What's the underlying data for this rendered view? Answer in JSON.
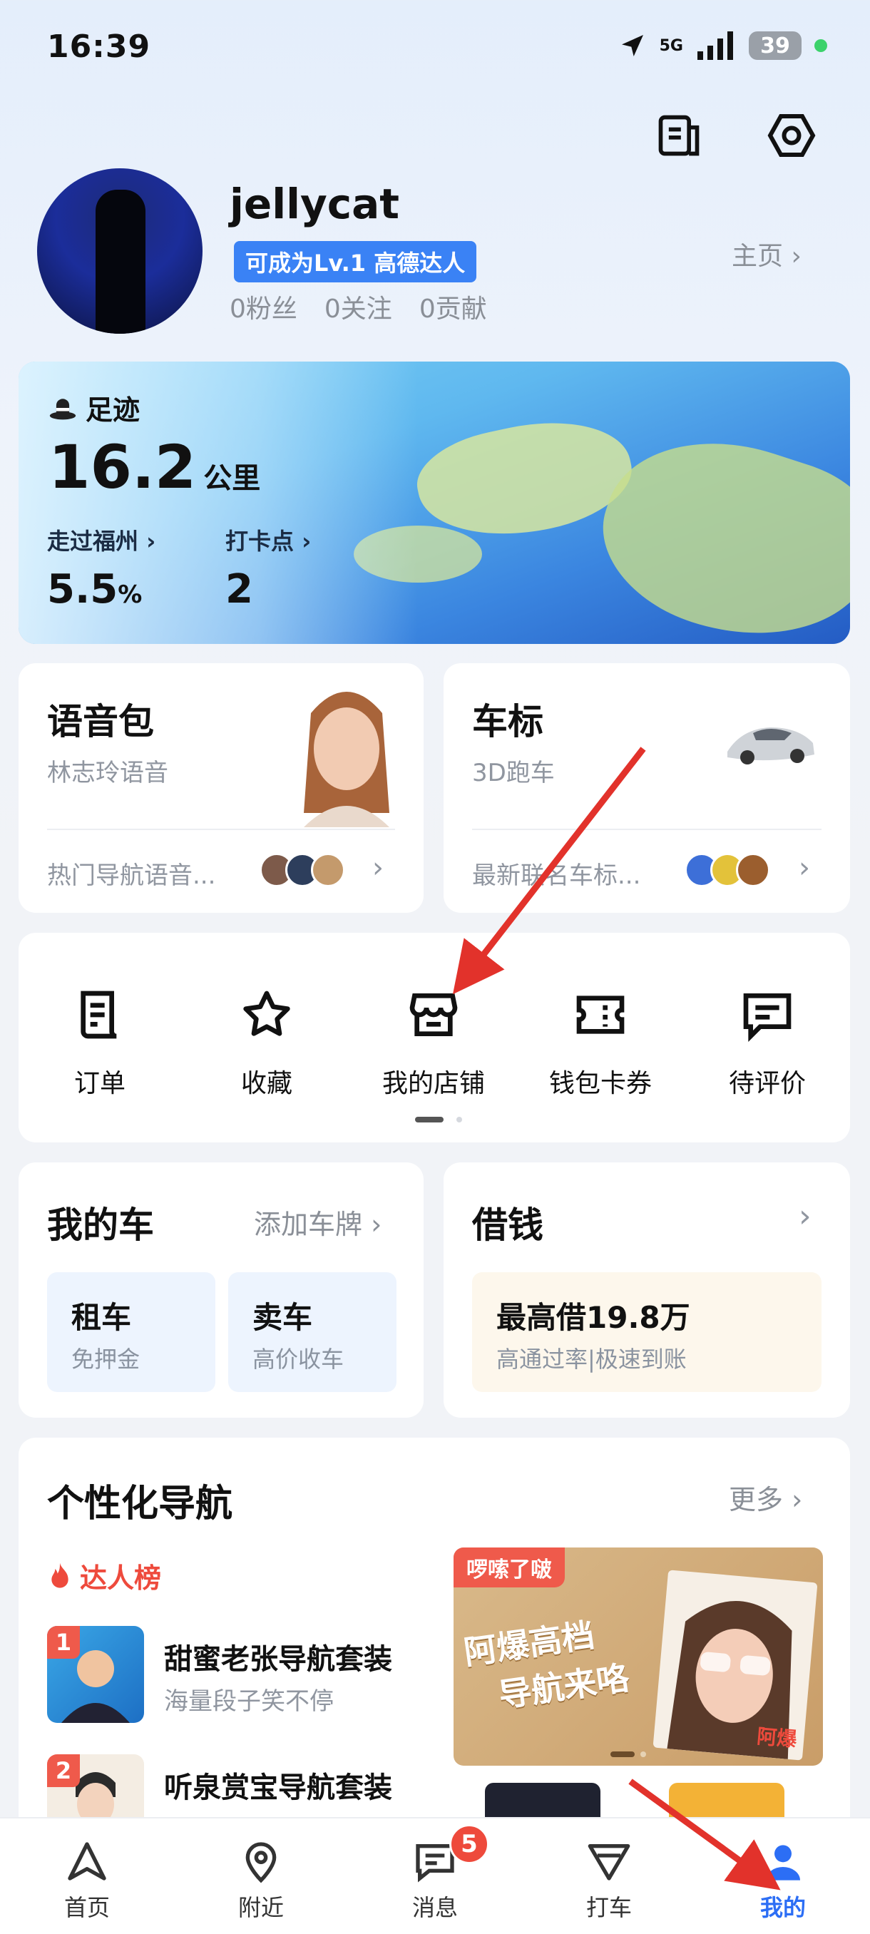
{
  "status": {
    "time": "16:39",
    "network": "5G",
    "battery": "39"
  },
  "header": {
    "icons": [
      "bill-icon",
      "settings-hexagon-icon"
    ]
  },
  "profile": {
    "username": "jellycat",
    "badge": "可成为Lv.1 高德达人",
    "stats": [
      "0粉丝",
      "0关注",
      "0贡献"
    ],
    "homepage_link": "主页"
  },
  "footprint": {
    "title": "足迹",
    "distance": "16.2",
    "distance_unit": "公里",
    "city_label": "走过福州",
    "city_value": "5.5",
    "city_unit": "%",
    "checkin_label": "打卡点",
    "checkin_value": "2"
  },
  "voice_pack": {
    "title": "语音包",
    "subtitle": "林志玲语音",
    "footer": "热门导航语音..."
  },
  "car_icon_card": {
    "title": "车标",
    "subtitle": "3D跑车",
    "footer": "最新联名车标..."
  },
  "quick_actions": [
    {
      "label": "订单",
      "icon": "order-icon"
    },
    {
      "label": "收藏",
      "icon": "star-icon"
    },
    {
      "label": "我的店铺",
      "icon": "shop-icon"
    },
    {
      "label": "钱包卡券",
      "icon": "wallet-coupon-icon"
    },
    {
      "label": "待评价",
      "icon": "review-icon"
    }
  ],
  "my_car": {
    "title": "我的车",
    "add_plate": "添加车牌",
    "rent": {
      "title": "租车",
      "subtitle": "免押金"
    },
    "sell": {
      "title": "卖车",
      "subtitle": "高价收车"
    }
  },
  "loan": {
    "title": "借钱",
    "headline": "最高借19.8万",
    "subtitle": "高通过率|极速到账"
  },
  "personal_nav": {
    "title": "个性化导航",
    "more": "更多",
    "rank_title": "达人榜",
    "items": [
      {
        "rank": "1",
        "title": "甜蜜老张导航套装",
        "subtitle": "海量段子笑不停"
      },
      {
        "rank": "2",
        "title": "听泉赏宝导航套装",
        "subtitle": ""
      }
    ],
    "promo": {
      "tag": "啰嗦了啵",
      "headline_line1": "阿爆高档",
      "headline_line2": "导航来咯",
      "name": "阿爆"
    }
  },
  "tabbar": {
    "items": [
      {
        "label": "首页",
        "icon": "home-triangle-icon"
      },
      {
        "label": "附近",
        "icon": "location-pin-icon"
      },
      {
        "label": "消息",
        "icon": "message-icon",
        "badge": "5"
      },
      {
        "label": "打车",
        "icon": "taxi-icon"
      },
      {
        "label": "我的",
        "icon": "profile-icon"
      }
    ],
    "active": "我的"
  },
  "colors": {
    "accent": "#2c6ef5",
    "badge": "#ee4a3c",
    "annotation_arrow": "#e2322b"
  }
}
